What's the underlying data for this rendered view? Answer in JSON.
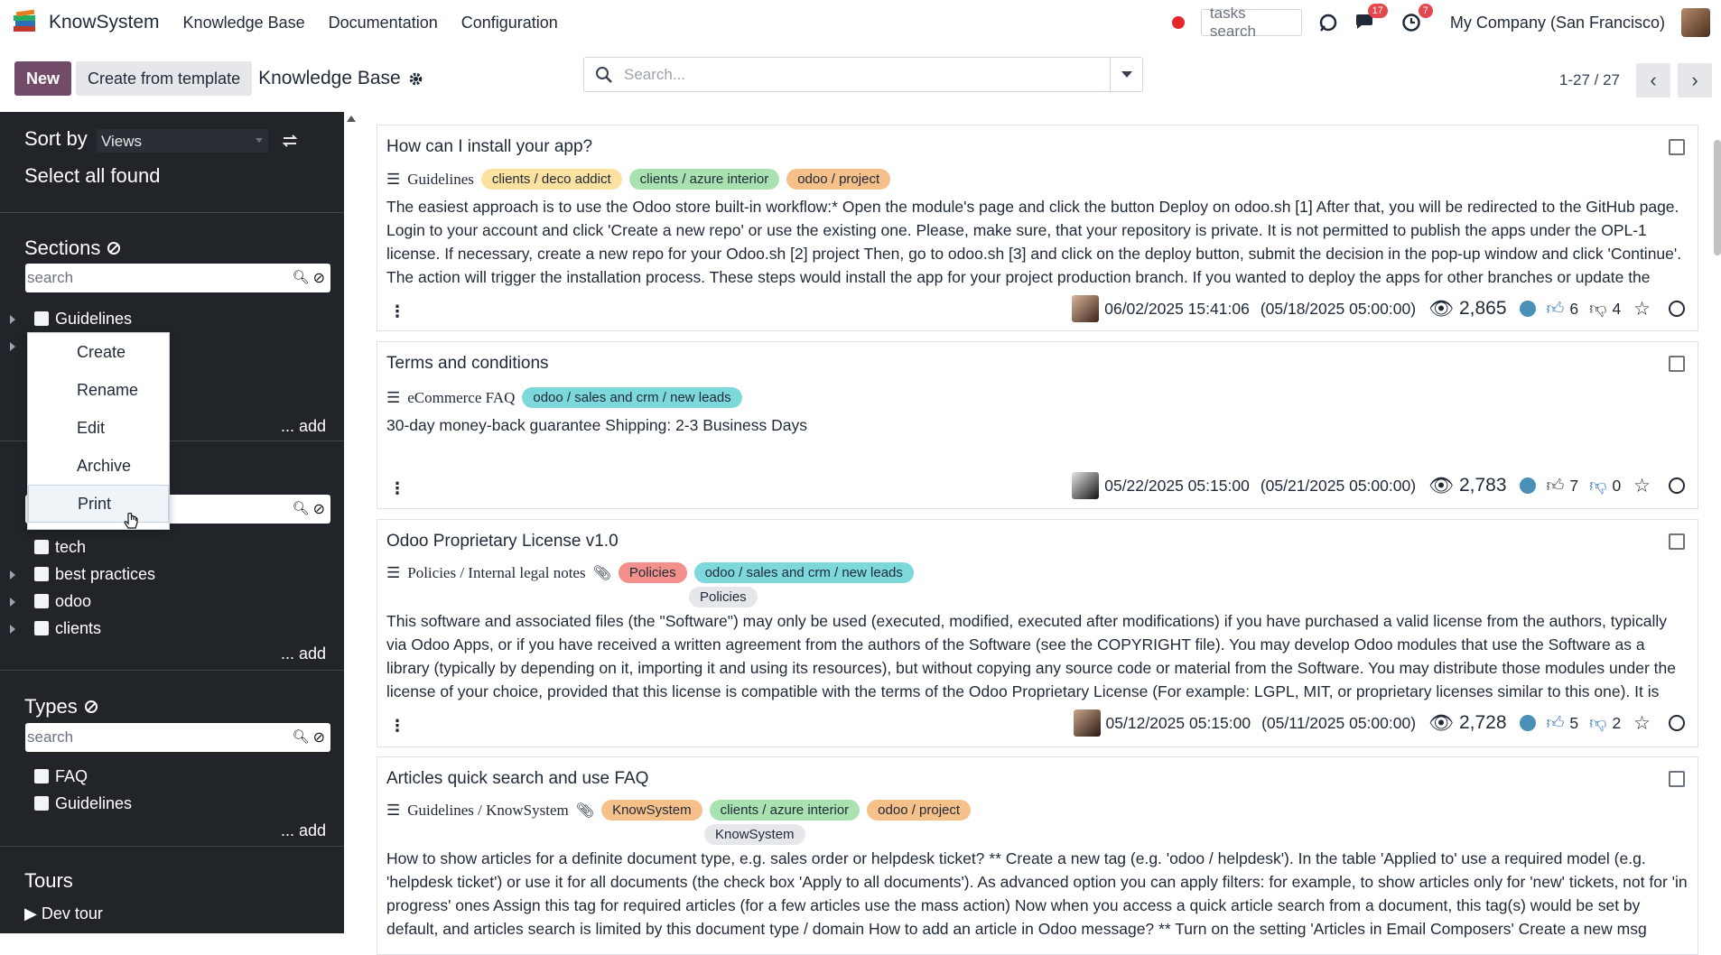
{
  "app": {
    "name": "KnowSystem"
  },
  "nav": {
    "menu": [
      "Knowledge Base",
      "Documentation",
      "Configuration"
    ],
    "tasks_placeholder": "tasks search",
    "messages_count": "17",
    "activities_count": "7",
    "company": "My Company (San Francisco)"
  },
  "control": {
    "new_label": "New",
    "template_label": "Create from template",
    "title": "Knowledge Base",
    "search_placeholder": "Search...",
    "pager": "1-27 / 27"
  },
  "sidebar": {
    "sort_label": "Sort by",
    "sort_value": "Views",
    "select_all": "Select all found",
    "sections_title": "Sections",
    "search_placeholder": "search",
    "sections": [
      {
        "label": "Guidelines"
      }
    ],
    "add_label": "... add",
    "tags": [
      {
        "label": "tech"
      },
      {
        "label": "best practices"
      },
      {
        "label": "odoo"
      },
      {
        "label": "clients"
      }
    ],
    "types_title": "Types",
    "types": [
      {
        "label": "FAQ"
      },
      {
        "label": "Guidelines"
      }
    ],
    "tours_title": "Tours",
    "tour_item": "▶ Dev tour"
  },
  "context_menu": [
    "Create",
    "Rename",
    "Edit",
    "Archive",
    "Print"
  ],
  "colors": {
    "primary": "#714b67",
    "sidebar_bg": "#212529",
    "badge": "#e4484d",
    "like": "#3b78c4",
    "globe": "#4a8fb8"
  },
  "articles": [
    {
      "title": "How can I install your app?",
      "section": "Guidelines",
      "tags": [
        "clients / deco addict",
        "clients / azure interior",
        "odoo / project"
      ],
      "body": "The easiest approach is to use the Odoo store built-in workflow:* Open the module's page and click the button Deploy on odoo.sh [1] After that, you will be redirected to the GitHub page. Login to your account and click 'Create a new repo' or use the existing one. Please, make sure, that your repository is private. It is not permitted to publish the apps under the OPL-1 license. If necessary, create a new repo for your Odoo.sh [2] project Then, go to odoo.sh [3] and click on the deploy button, submit the decision in the pop-up window and click 'Continue'. The action will trigger the installation process. These steps would install the app for your project production branch. If you wanted to deploy the apps for other branches or update the",
      "date": "06/02/2025 15:41:06",
      "due": "(05/18/2025 05:00:00)",
      "views": "2,865",
      "likes": "6",
      "dislikes": "4"
    },
    {
      "title": "Terms and conditions",
      "section": "eCommerce FAQ",
      "tags": [
        "odoo / sales and crm / new leads"
      ],
      "body": "30-day money-back guarantee Shipping: 2-3 Business Days",
      "date": "05/22/2025 05:15:00",
      "due": "(05/21/2025 05:00:00)",
      "views": "2,783",
      "likes": "7",
      "dislikes": "0"
    },
    {
      "title": "Odoo Proprietary License v1.0",
      "section": "Policies / Internal legal notes",
      "tags": [
        "Policies",
        "odoo / sales and crm / new leads"
      ],
      "subtag": "Policies",
      "body": "This software and associated files (the \"Software\") may only be used (executed, modified, executed after modifications) if you have purchased a valid license from the authors, typically via Odoo Apps, or if you have received a written agreement from the authors of the Software (see the COPYRIGHT file). You may develop Odoo modules that use the Software as a library (typically by depending on it, importing it and using its resources), but without copying any source code or material from the Software. You may distribute those modules under the license of your choice, provided that this license is compatible with the terms of the Odoo Proprietary License (For example: LGPL, MIT, or proprietary licenses similar to this one). It is forbidden to",
      "date": "05/12/2025 05:15:00",
      "due": "(05/11/2025 05:00:00)",
      "views": "2,728",
      "likes": "5",
      "dislikes": "2"
    },
    {
      "title": "Articles quick search and use FAQ",
      "section": "Guidelines / KnowSystem",
      "tags": [
        "KnowSystem",
        "clients / azure interior",
        "odoo / project"
      ],
      "subtag": "KnowSystem",
      "body": "How to show articles for a definite document type, e.g. sales order or helpdesk ticket? ** Create a new tag (e.g. 'odoo / helpdesk'). In the table 'Applied to' use a required model (e.g. 'helpdesk ticket') or use it for all documents (the check box 'Apply to all documents'). As advanced option you can apply filters: for example, to show articles only for 'new' tickets, not for 'in progress' ones Assign this tag for required articles (for a few articles use the mass action) Now when you access a quick article search from a document, this tag(s) would be set by default, and articles search is limited by this document type / domain How to add an article in Odoo message? ** Turn on the setting 'Articles in Email Composers' Create a new msg"
    }
  ]
}
